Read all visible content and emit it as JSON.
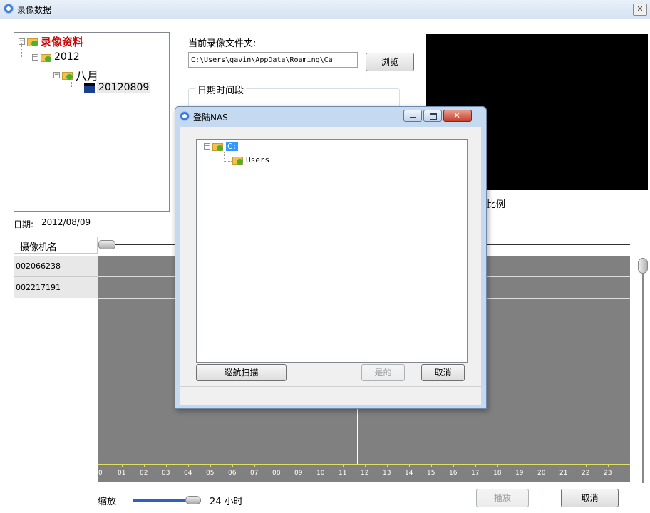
{
  "window": {
    "title": "录像数据"
  },
  "tree": {
    "root": "录像资料",
    "year": "2012",
    "month": "八月",
    "day": "20120809"
  },
  "folder_panel": {
    "label": "当前录像文件夹:",
    "path": "C:\\Users\\gavin\\AppData\\Roaming\\Ca",
    "browse": "浏览",
    "group_title": "日期时间段"
  },
  "ratio_text": "比例",
  "date": {
    "label": "日期:",
    "value": "2012/08/09"
  },
  "timeline": {
    "column_header": "摄像机名",
    "cameras": [
      "002066238",
      "002217191"
    ],
    "hours": [
      "0",
      "01",
      "02",
      "03",
      "04",
      "05",
      "06",
      "07",
      "08",
      "09",
      "10",
      "11",
      "12",
      "13",
      "14",
      "15",
      "16",
      "17",
      "18",
      "19",
      "20",
      "21",
      "22",
      "23"
    ]
  },
  "zoom": {
    "label": "缩放",
    "value": "24 小时",
    "level_fraction": 1.0
  },
  "bottom_buttons": {
    "play": "播放",
    "cancel": "取消"
  },
  "dialog": {
    "title": "登陆NAS",
    "tree_root": "C:",
    "tree_child": "Users",
    "scan": "巡航扫描",
    "yes": "是的",
    "cancel": "取消"
  },
  "colors": {
    "timeline_bg": "#808080",
    "title_bar": "#dde8f5",
    "dialog_frame": "#b9d1ea",
    "accent_red": "#cc0000"
  }
}
